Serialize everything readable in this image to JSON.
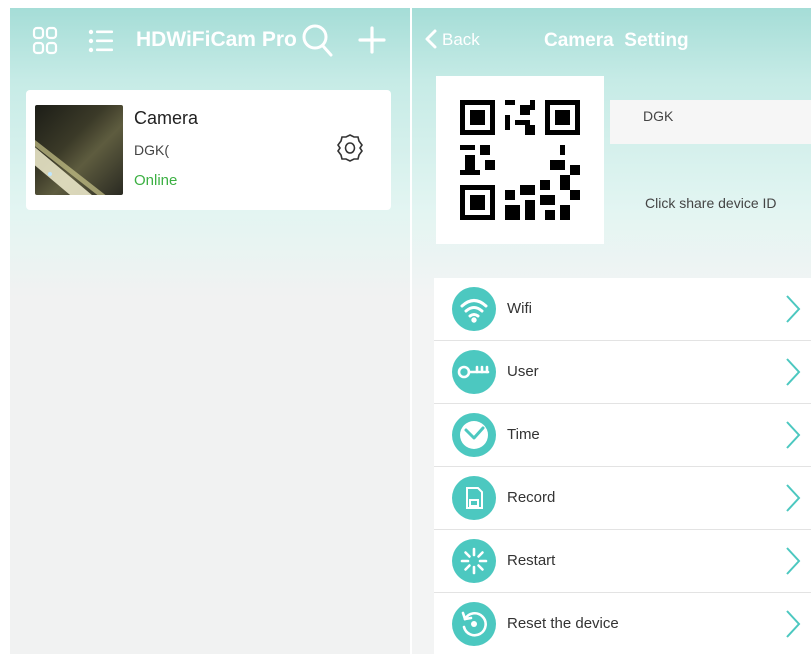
{
  "list_screen": {
    "title": "HDWiFiCam Pro",
    "icons": [
      "grid-view-icon",
      "list-view-icon",
      "search-icon",
      "add-icon"
    ],
    "camera": {
      "name": "Camera",
      "id": "DGK(",
      "status": "Online"
    }
  },
  "settings_screen": {
    "back_label": "Back",
    "title": "Camera  Setting",
    "device_id": "DGK",
    "share_hint": "Click share device ID",
    "menu": [
      {
        "label": "Wifi",
        "icon": "wifi-icon"
      },
      {
        "label": "User",
        "icon": "key-icon"
      },
      {
        "label": "Time",
        "icon": "clock-icon"
      },
      {
        "label": "Record",
        "icon": "sd-card-icon"
      },
      {
        "label": "Restart",
        "icon": "restart-spinner-icon"
      },
      {
        "label": "Reset the device",
        "icon": "reset-icon"
      }
    ]
  },
  "colors": {
    "header_teal": "#a5ddd7",
    "icon_teal": "#4cc8c0",
    "online_green": "#3cb043"
  }
}
